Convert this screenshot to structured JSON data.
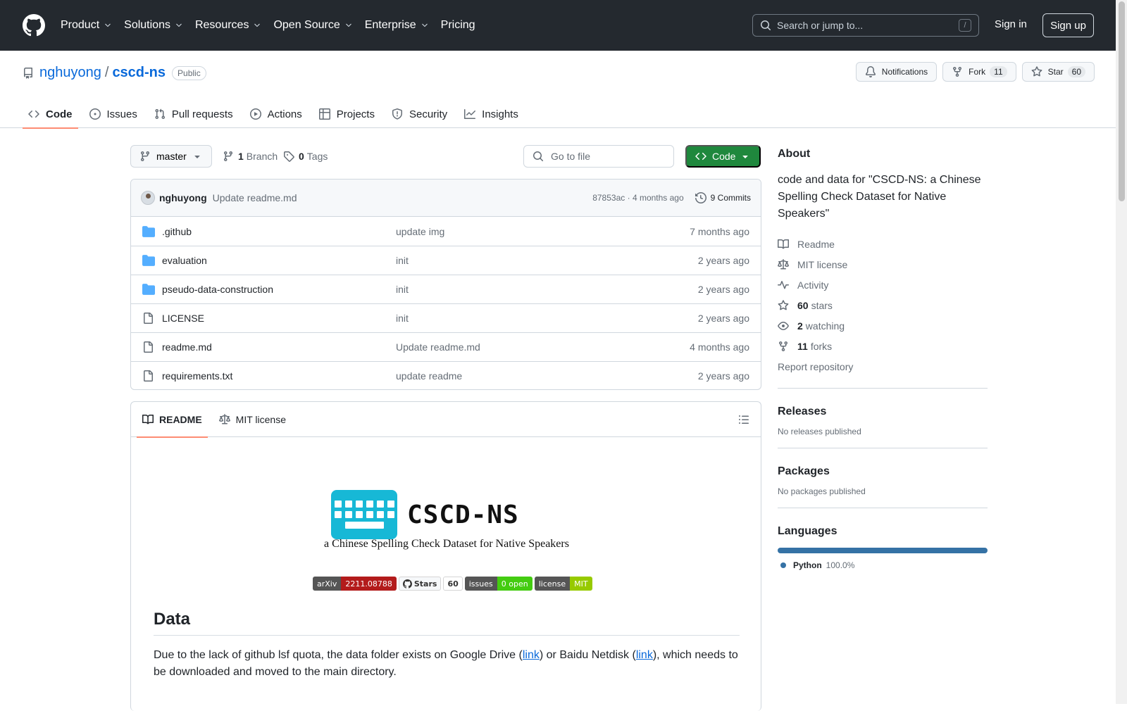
{
  "nav": {
    "items": [
      {
        "label": "Product",
        "caret": true
      },
      {
        "label": "Solutions",
        "caret": true
      },
      {
        "label": "Resources",
        "caret": true
      },
      {
        "label": "Open Source",
        "caret": true
      },
      {
        "label": "Enterprise",
        "caret": true
      },
      {
        "label": "Pricing",
        "caret": false
      }
    ],
    "search_placeholder": "Search or jump to...",
    "search_shortcut": "/",
    "signin": "Sign in",
    "signup": "Sign up"
  },
  "repo": {
    "owner": "nghuyong",
    "separator": "/",
    "name": "cscd-ns",
    "visibility": "Public",
    "notifications_label": "Notifications",
    "fork_label": "Fork",
    "fork_count": "11",
    "star_label": "Star",
    "star_count": "60"
  },
  "tabs": [
    {
      "label": "Code",
      "icon": "code-icon",
      "active": true
    },
    {
      "label": "Issues",
      "icon": "issue-icon",
      "active": false
    },
    {
      "label": "Pull requests",
      "icon": "pull-request-icon",
      "active": false
    },
    {
      "label": "Actions",
      "icon": "play-icon",
      "active": false
    },
    {
      "label": "Projects",
      "icon": "table-icon",
      "active": false
    },
    {
      "label": "Security",
      "icon": "shield-icon",
      "active": false
    },
    {
      "label": "Insights",
      "icon": "graph-icon",
      "active": false
    }
  ],
  "toolbar": {
    "branch": "master",
    "branch_count": "1",
    "branch_label": "Branch",
    "tag_count": "0",
    "tag_label": "Tags",
    "goto_placeholder": "Go to file",
    "code_button": "Code"
  },
  "commit": {
    "user": "nghuyong",
    "message": "Update readme.md",
    "hash": "87853ac",
    "separator": "·",
    "time": "4 months ago",
    "count": "9 Commits"
  },
  "files": [
    {
      "name": ".github",
      "type": "folder",
      "message": "update img",
      "date": "7 months ago"
    },
    {
      "name": "evaluation",
      "type": "folder",
      "message": "init",
      "date": "2 years ago"
    },
    {
      "name": "pseudo-data-construction",
      "type": "folder",
      "message": "init",
      "date": "2 years ago"
    },
    {
      "name": "LICENSE",
      "type": "file",
      "message": "init",
      "date": "2 years ago"
    },
    {
      "name": "readme.md",
      "type": "file",
      "message": "Update readme.md",
      "date": "4 months ago"
    },
    {
      "name": "requirements.txt",
      "type": "file",
      "message": "update readme",
      "date": "2 years ago"
    }
  ],
  "readme": {
    "tab_readme": "README",
    "tab_license": "MIT license",
    "logo_text": "CSCD-NS",
    "tagline": "a Chinese Spelling Check Dataset for Native Speakers",
    "shields": {
      "arxiv_l": "arXiv",
      "arxiv_r": "2211.08788",
      "arxiv_color": "#b31b1b",
      "stars_l": "Stars",
      "stars_r": "60",
      "issues_l": "issues",
      "issues_r": "0 open",
      "issues_color": "#4c1",
      "license_l": "license",
      "license_r": "MIT",
      "license_color": "#97ca00"
    },
    "heading": "Data",
    "para_1": "Due to the lack of github lsf quota, the data folder exists on Google Drive (",
    "link_1": "link",
    "para_2": ") or Baidu Netdisk (",
    "link_2": "link",
    "para_3": "), which needs to be downloaded and moved to the main directory."
  },
  "sidebar": {
    "about_title": "About",
    "description": "code and data for \"CSCD-NS: a Chinese Spelling Check Dataset for Native Speakers\"",
    "links": [
      {
        "icon": "book-icon",
        "strong": "",
        "text": "Readme"
      },
      {
        "icon": "law-icon",
        "strong": "",
        "text": "MIT license"
      },
      {
        "icon": "pulse-icon",
        "strong": "",
        "text": "Activity"
      },
      {
        "icon": "star-icon",
        "strong": "60",
        "text": "stars"
      },
      {
        "icon": "eye-icon",
        "strong": "2",
        "text": "watching"
      },
      {
        "icon": "fork-icon",
        "strong": "11",
        "text": "forks"
      }
    ],
    "report": "Report repository",
    "releases_title": "Releases",
    "releases_text": "No releases published",
    "packages_title": "Packages",
    "packages_text": "No packages published",
    "languages_title": "Languages",
    "language_name": "Python",
    "language_pct": "100.0%",
    "language_color": "#3572a5"
  }
}
